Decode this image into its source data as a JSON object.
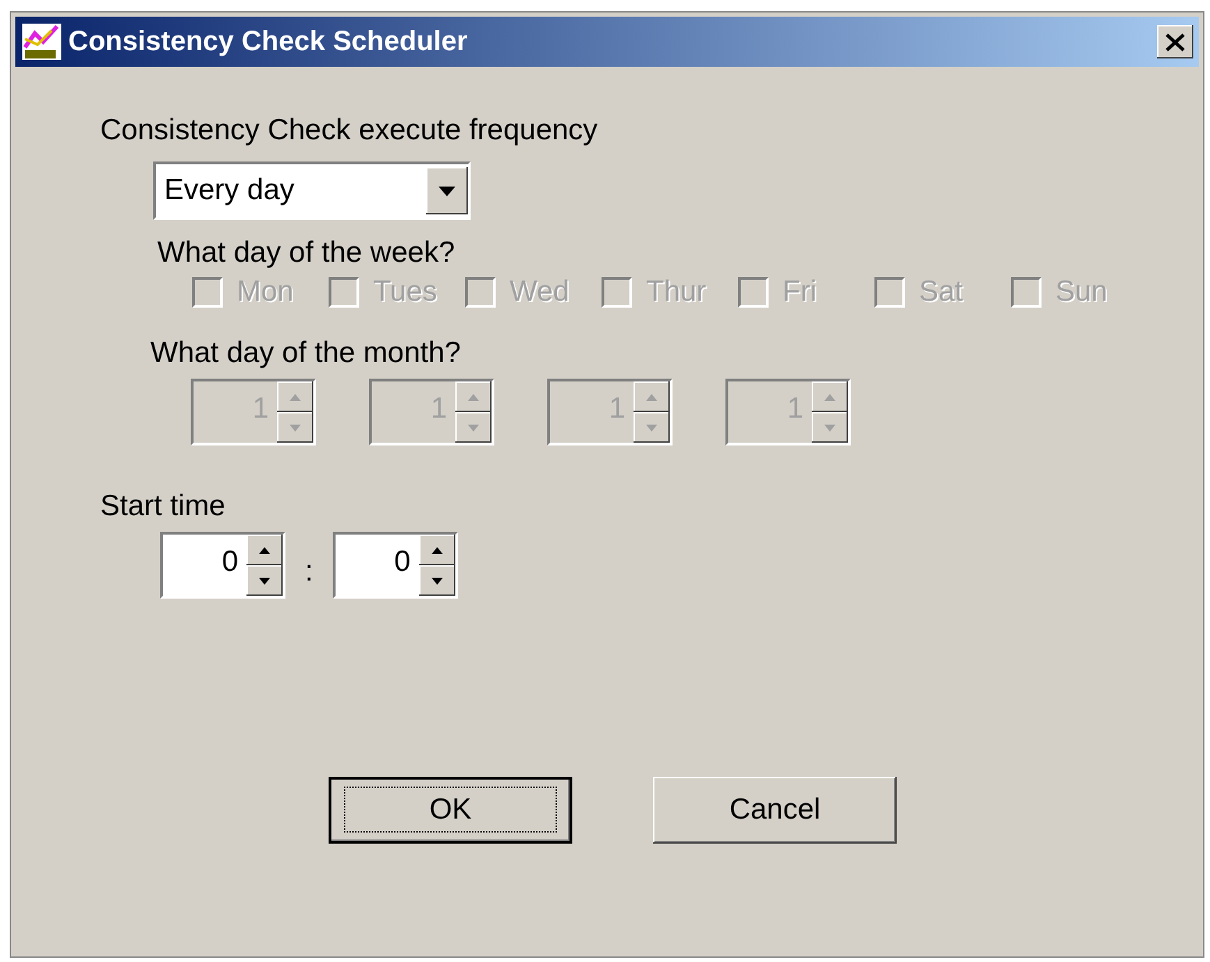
{
  "window": {
    "title": "Consistency Check Scheduler"
  },
  "frequency": {
    "label": "Consistency Check execute frequency",
    "value": "Every day"
  },
  "week": {
    "label": "What day of the week?",
    "days": [
      {
        "label": "Mon",
        "checked": false,
        "disabled": true
      },
      {
        "label": "Tues",
        "checked": false,
        "disabled": true
      },
      {
        "label": "Wed",
        "checked": false,
        "disabled": true
      },
      {
        "label": "Thur",
        "checked": false,
        "disabled": true
      },
      {
        "label": "Fri",
        "checked": false,
        "disabled": true
      },
      {
        "label": "Sat",
        "checked": false,
        "disabled": true
      },
      {
        "label": "Sun",
        "checked": false,
        "disabled": true
      }
    ]
  },
  "month": {
    "label": "What day of the month?",
    "days": [
      {
        "value": "1",
        "disabled": true
      },
      {
        "value": "1",
        "disabled": true
      },
      {
        "value": "1",
        "disabled": true
      },
      {
        "value": "1",
        "disabled": true
      }
    ]
  },
  "start_time": {
    "label": "Start time",
    "separator": ":",
    "fields": [
      {
        "value": "0",
        "disabled": false
      },
      {
        "value": "0",
        "disabled": false
      }
    ]
  },
  "buttons": [
    {
      "label": "OK",
      "default": true
    },
    {
      "label": "Cancel",
      "default": false
    }
  ]
}
